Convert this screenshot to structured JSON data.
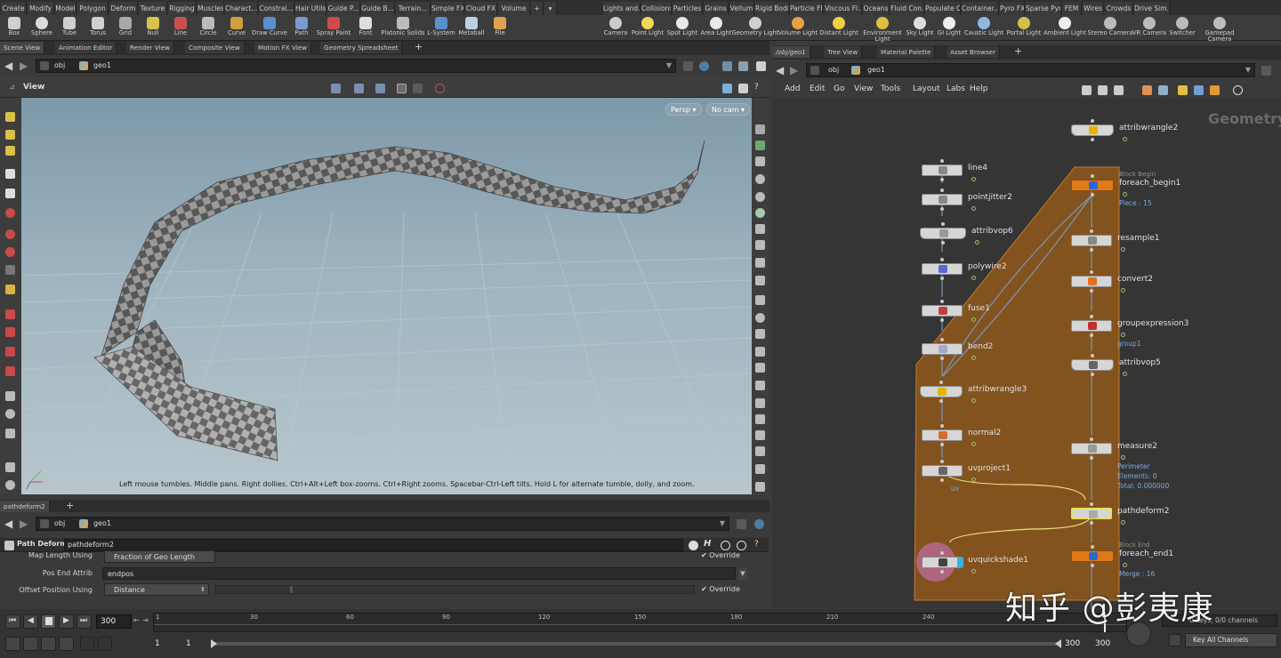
{
  "shelf_tabs_left": [
    "Create",
    "Modify",
    "Model",
    "Polygon",
    "Deform",
    "Texture",
    "Rigging",
    "Muscles",
    "Charact...",
    "Constrai...",
    "Hair Utils",
    "Guide P...",
    "Guide B...",
    "Terrain...",
    "Simple FX",
    "Cloud FX",
    "Volume"
  ],
  "shelf_tabs_right": [
    "Lights and...",
    "Collisions",
    "Particles",
    "Grains",
    "Vellum",
    "Rigid Bodies",
    "Particle Fl...",
    "Viscous Fl...",
    "Oceans",
    "Fluid Con...",
    "Populate C...",
    "Container...",
    "Pyro FX",
    "Sparse Pyr...",
    "FEM",
    "Wires",
    "Crowds",
    "Drive Sim..."
  ],
  "shelf_tools_left": [
    "Box",
    "Sphere",
    "Tube",
    "Torus",
    "Grid",
    "Null",
    "Line",
    "Circle",
    "Curve",
    "Draw Curve",
    "Path",
    "Spray Paint",
    "Font",
    "Platonic Solids",
    "L-System",
    "Metaball",
    "File"
  ],
  "shelf_tools_right": [
    "Camera",
    "Point Light",
    "Spot Light",
    "Area Light",
    "Geometry Light",
    "Volume Light",
    "Distant Light",
    "Environment Light",
    "Sky Light",
    "GI Light",
    "Caustic Light",
    "Portal Light",
    "Ambient Light",
    "Stereo Camera",
    "VR Camera",
    "Switcher",
    "Gamepad Camera"
  ],
  "left_pane_tabs": [
    "Scene View",
    "Animation Editor",
    "Render View",
    "Composite View",
    "Motion FX View",
    "Geometry Spreadsheet"
  ],
  "right_pane_tabs": [
    "/obj/geo1",
    "Tree View",
    "Material Palette",
    "Asset Browser"
  ],
  "path": {
    "obj": "obj",
    "geo": "geo1"
  },
  "viewport": {
    "title": "View",
    "persp": "Persp",
    "cam": "No cam",
    "hint": "Left mouse tumbles. Middle pans. Right dollies. Ctrl+Alt+Left box-zooms. Ctrl+Right zooms. Spacebar-Ctrl-Left tilts. Hold L for alternate tumble, dolly, and zoom."
  },
  "network": {
    "menu": [
      "Add",
      "Edit",
      "Go",
      "View",
      "Tools",
      "Layout",
      "Labs",
      "Help"
    ],
    "context_label": "Geometry",
    "nodes": [
      {
        "name": "attribwrangle2"
      },
      {
        "name": "line4"
      },
      {
        "name": "pointjitter2"
      },
      {
        "name": "attribvop6"
      },
      {
        "name": "polywire2"
      },
      {
        "name": "fuse1"
      },
      {
        "name": "bend2"
      },
      {
        "name": "attribwrangle3"
      },
      {
        "name": "normal2"
      },
      {
        "name": "uvproject1",
        "sub": "uv"
      },
      {
        "name": "uvquickshade1"
      },
      {
        "name": "foreach_begin1",
        "pre": "Block Begin",
        "sub": "Piece : 15"
      },
      {
        "name": "resample1"
      },
      {
        "name": "convert2"
      },
      {
        "name": "groupexpression3",
        "sub": "group1"
      },
      {
        "name": "attribvop5"
      },
      {
        "name": "measure2",
        "sub": "Perimeter",
        "sub2": "Elements: 0",
        "sub3": "Total: 0.000000"
      },
      {
        "name": "pathdeform2"
      },
      {
        "name": "foreach_end1",
        "pre": "Block End",
        "sub": "Merge : 16"
      }
    ]
  },
  "params": {
    "tab": "pathdeform2",
    "node_type": "Path Deform",
    "node_name": "pathdeform2",
    "row1_label": "Map Length Using",
    "row1_value": "Fraction of Geo Length",
    "row1_override": "Override",
    "row2_label": "Pos End Attrib",
    "row2_value": "endpos",
    "row3_label": "Offset Position Using",
    "row3_value": "Distance",
    "row3_override": "Override"
  },
  "timeline": {
    "frame": "300",
    "ticks": [
      "1",
      "30",
      "60",
      "90",
      "120",
      "150",
      "180",
      "210",
      "240",
      "270"
    ],
    "start1": "1",
    "start2": "1",
    "end1": "300",
    "end2": "300",
    "keys": "0 keys, 0/0 channels",
    "key_all": "Key All Channels"
  },
  "watermark": "知乎 @彭夷康"
}
